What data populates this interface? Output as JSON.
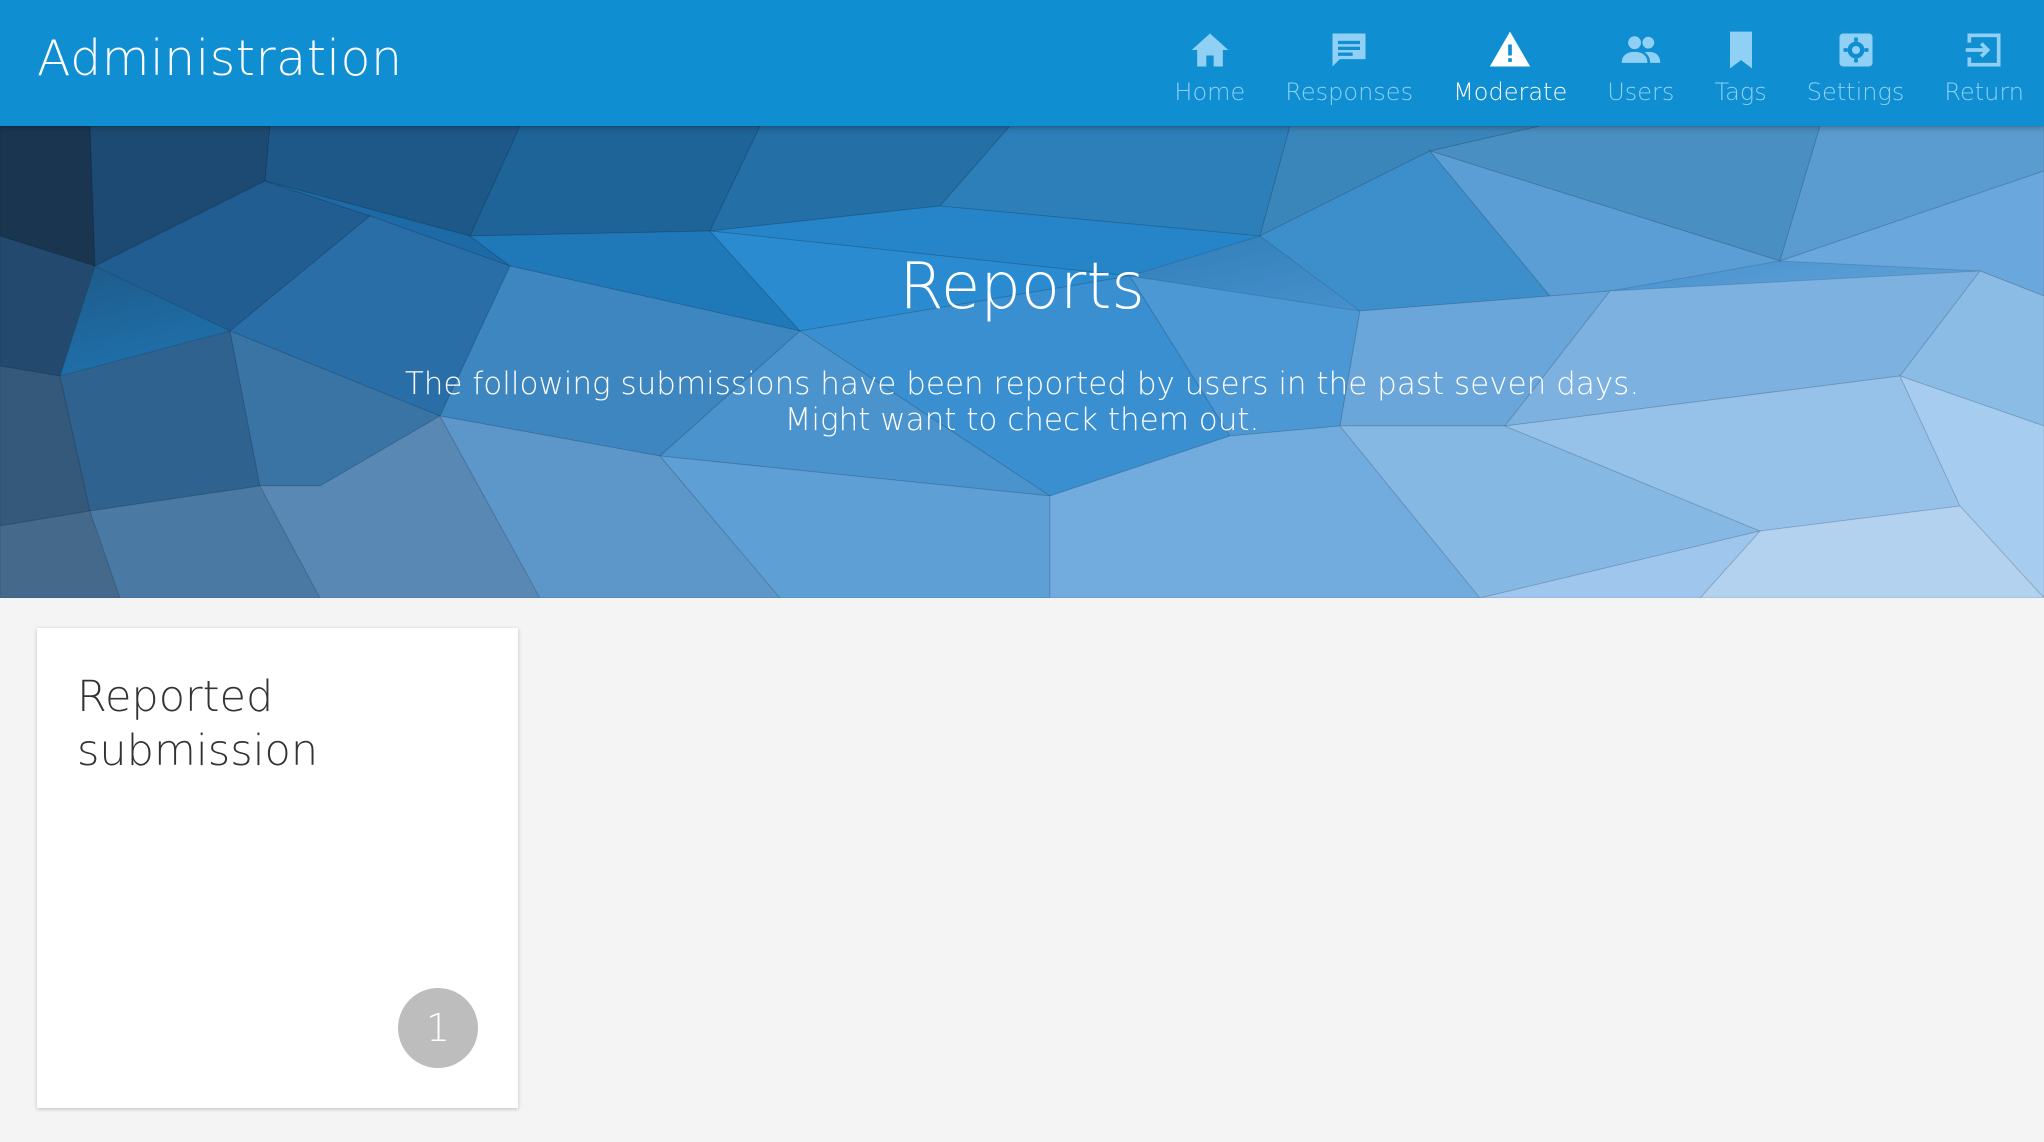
{
  "header": {
    "brand": "Administration",
    "nav": [
      {
        "label": "Home",
        "icon": "home-icon",
        "active": false
      },
      {
        "label": "Responses",
        "icon": "chat-icon",
        "active": false
      },
      {
        "label": "Moderate",
        "icon": "warning-icon",
        "active": true
      },
      {
        "label": "Users",
        "icon": "users-icon",
        "active": false
      },
      {
        "label": "Tags",
        "icon": "bookmark-icon",
        "active": false
      },
      {
        "label": "Settings",
        "icon": "gear-icon",
        "active": false
      },
      {
        "label": "Return",
        "icon": "exit-icon",
        "active": false
      }
    ]
  },
  "hero": {
    "title": "Reports",
    "subtitle": "The following submissions have been reported by users in the past seven days. Might want to check them out."
  },
  "cards": [
    {
      "title": "Reported submission",
      "count": "1"
    }
  ],
  "colors": {
    "topbar": "#0f8fd2",
    "nav_inactive": "#8fd0f4",
    "nav_active": "#ffffff",
    "page_background": "#f4f4f4",
    "badge": "#bdbdbd"
  }
}
